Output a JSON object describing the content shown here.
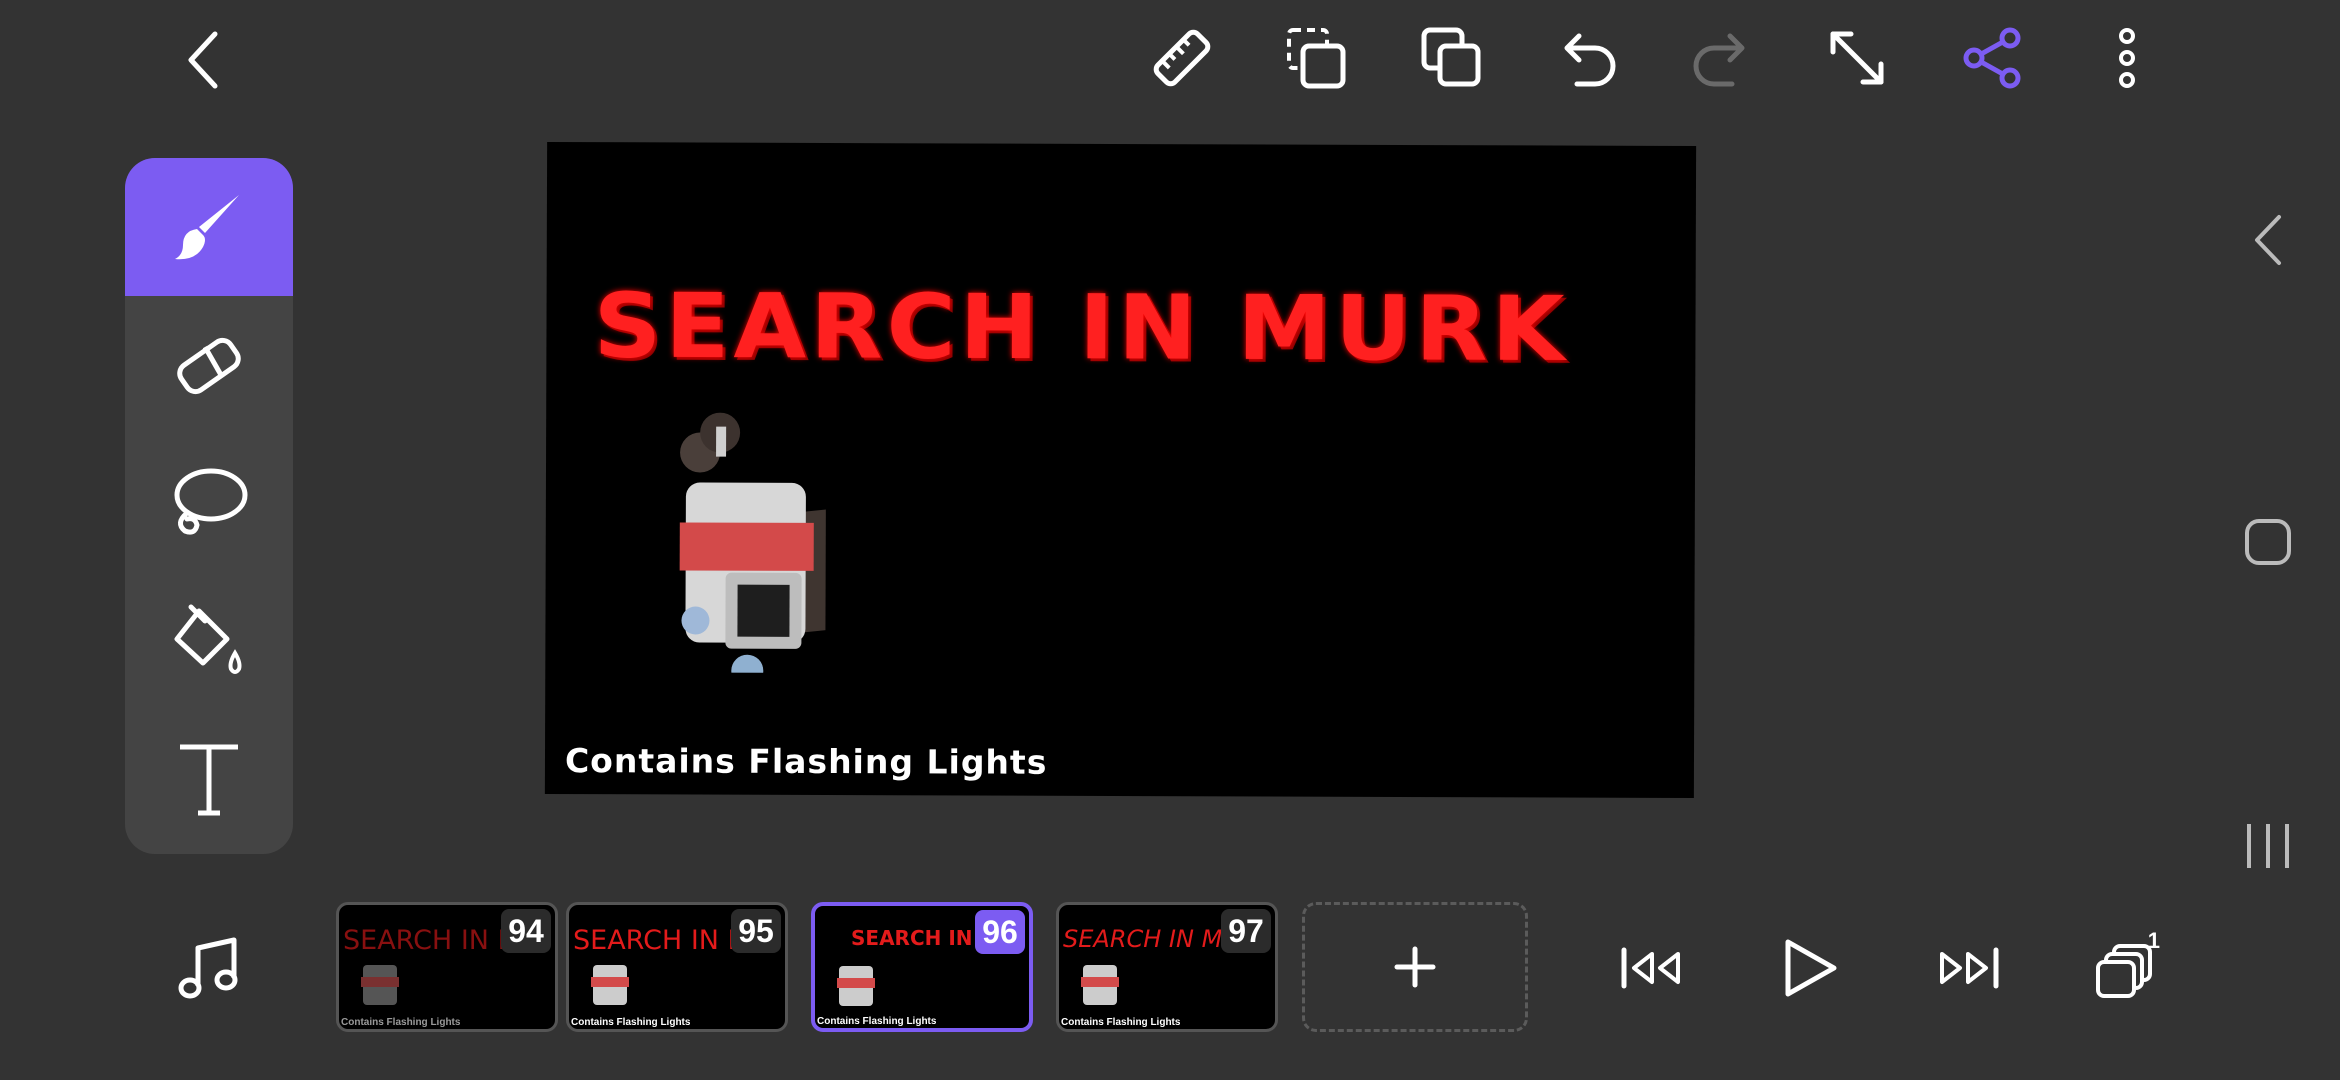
{
  "canvas": {
    "title": "SEARCH IN MURK",
    "warning": "Contains Flashing Lights"
  },
  "toolbar": {
    "icons": [
      "back-icon",
      "ruler-icon",
      "select-icon",
      "copy-layer-icon",
      "undo-icon",
      "redo-icon",
      "resize-icon",
      "share-icon",
      "more-icon"
    ]
  },
  "tools": [
    "brush-icon",
    "eraser-icon",
    "lasso-icon",
    "fill-icon",
    "text-icon"
  ],
  "frames": [
    {
      "number": "94",
      "thumb_text": "SEARCH IN MU",
      "thumb_warn": "Contains Flashing Lights"
    },
    {
      "number": "95",
      "thumb_text": "SEARCH IN MU",
      "thumb_warn": "Contains Flashing Lights"
    },
    {
      "number": "96",
      "thumb_text": "SEARCH IN MU",
      "thumb_warn": "Contains Flashing Lights"
    },
    {
      "number": "97",
      "thumb_text": "SEARCH IN MU",
      "thumb_warn": "Contains Flashing Lights"
    }
  ],
  "layers_badge": "1",
  "colors": {
    "accent": "#7c5cf2",
    "background": "#333333",
    "panel": "#444444",
    "title_red": "#ff2020"
  }
}
